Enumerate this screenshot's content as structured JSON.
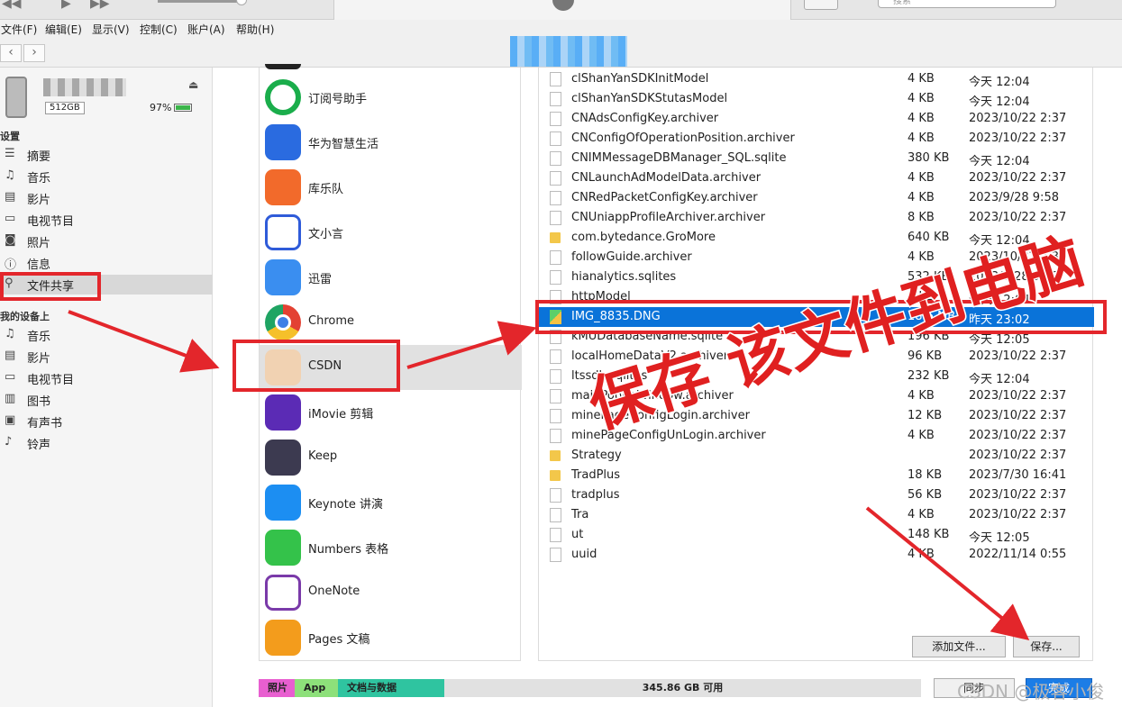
{
  "menu": [
    "文件(F)",
    "编辑(E)",
    "显示(V)",
    "控制(C)",
    "账户(A)",
    "帮助(H)"
  ],
  "search_placeholder": "搜索",
  "device": {
    "storage": "512GB",
    "battery": "97%"
  },
  "sidebar": {
    "settings_title": "设置",
    "settings": [
      {
        "label": "摘要",
        "icon": "list-icon"
      },
      {
        "label": "音乐",
        "icon": "music-icon"
      },
      {
        "label": "影片",
        "icon": "film-icon"
      },
      {
        "label": "电视节目",
        "icon": "tv-icon"
      },
      {
        "label": "照片",
        "icon": "camera-icon"
      },
      {
        "label": "信息",
        "icon": "info-icon"
      },
      {
        "label": "文件共享",
        "icon": "app-store-icon"
      }
    ],
    "mydevice_title": "我的设备上",
    "mydevice": [
      {
        "label": "音乐",
        "icon": "music-icon"
      },
      {
        "label": "影片",
        "icon": "film-icon"
      },
      {
        "label": "电视节目",
        "icon": "tv-icon"
      },
      {
        "label": "图书",
        "icon": "book-icon"
      },
      {
        "label": "有声书",
        "icon": "audiobook-icon"
      },
      {
        "label": "铃声",
        "icon": "bell-icon"
      }
    ]
  },
  "apps": [
    {
      "name": "订阅号助手",
      "color": "#1aad4b"
    },
    {
      "name": "华为智慧生活",
      "color": "#2a6be0"
    },
    {
      "name": "库乐队",
      "color": "#f26a2b"
    },
    {
      "name": "文小言",
      "color": "#2f5bd9"
    },
    {
      "name": "迅雷",
      "color": "#3a8ef0"
    },
    {
      "name": "Chrome",
      "color": "#e34133"
    },
    {
      "name": "CSDN",
      "color": "#f1d2b2"
    },
    {
      "name": "iMovie 剪辑",
      "color": "#5b2bb5"
    },
    {
      "name": "Keep",
      "color": "#3c3a50"
    },
    {
      "name": "Keynote 讲演",
      "color": "#1c8ef2"
    },
    {
      "name": "Numbers 表格",
      "color": "#34c24a"
    },
    {
      "name": "OneNote",
      "color": "#7a3aa9"
    },
    {
      "name": "Pages 文稿",
      "color": "#f39c1c"
    }
  ],
  "files": [
    {
      "name": "clShanYanSDKInitModel",
      "size": "4 KB",
      "date": "今天 12:04",
      "type": "file"
    },
    {
      "name": "clShanYanSDKStutasModel",
      "size": "4 KB",
      "date": "今天 12:04",
      "type": "file"
    },
    {
      "name": "CNAdsConfigKey.archiver",
      "size": "4 KB",
      "date": "2023/10/22 2:37",
      "type": "file"
    },
    {
      "name": "CNConfigOfOperationPosition.archiver",
      "size": "4 KB",
      "date": "2023/10/22 2:37",
      "type": "file"
    },
    {
      "name": "CNIMMessageDBManager_SQL.sqlite",
      "size": "380 KB",
      "date": "今天 12:04",
      "type": "file"
    },
    {
      "name": "CNLaunchAdModelData.archiver",
      "size": "4 KB",
      "date": "2023/10/22 2:37",
      "type": "file"
    },
    {
      "name": "CNRedPacketConfigKey.archiver",
      "size": "4 KB",
      "date": "2023/9/28 9:58",
      "type": "file"
    },
    {
      "name": "CNUniappProfileArchiver.archiver",
      "size": "8 KB",
      "date": "2023/10/22 2:37",
      "type": "file"
    },
    {
      "name": "com.bytedance.GroMore",
      "size": "640 KB",
      "date": "今天 12:04",
      "type": "folder"
    },
    {
      "name": "followGuide.archiver",
      "size": "4 KB",
      "date": "2023/10/22 2:37",
      "type": "file"
    },
    {
      "name": "hianalytics.sqlites",
      "size": "532 KB",
      "date": "2023/9/28 9:59",
      "type": "file"
    },
    {
      "name": "httpModel",
      "size": "4 KB",
      "date": "今天 12:04",
      "type": "file"
    },
    {
      "name": "IMG_8835.DNG",
      "size": "18.6 MB",
      "date": "昨天 23:02",
      "type": "image",
      "selected": true
    },
    {
      "name": "kMUDatabaseName.sqlite",
      "size": "196 KB",
      "date": "今天 12:05",
      "type": "file"
    },
    {
      "name": "localHomeDataV2.archiver",
      "size": "96 KB",
      "date": "2023/10/22 2:37",
      "type": "file"
    },
    {
      "name": "ltssdk.sqlites",
      "size": "232 KB",
      "date": "今天 12:04",
      "type": "file"
    },
    {
      "name": "mainPopupWindow.archiver",
      "size": "4 KB",
      "date": "2023/10/22 2:37",
      "type": "file"
    },
    {
      "name": "minePageConfigLogin.archiver",
      "size": "12 KB",
      "date": "2023/10/22 2:37",
      "type": "file"
    },
    {
      "name": "minePageConfigUnLogin.archiver",
      "size": "4 KB",
      "date": "2023/10/22 2:37",
      "type": "file"
    },
    {
      "name": "Strategy",
      "size": "",
      "date": "2023/10/22 2:37",
      "type": "folder"
    },
    {
      "name": "TradPlus",
      "size": "18 KB",
      "date": "2023/7/30 16:41",
      "type": "folder"
    },
    {
      "name": "tradplus",
      "size": "56 KB",
      "date": "2023/10/22 2:37",
      "type": "file"
    },
    {
      "name": "Tra",
      "size": "4 KB",
      "date": "2023/10/22 2:37",
      "type": "file"
    },
    {
      "name": "ut",
      "size": "148 KB",
      "date": "今天 12:05",
      "type": "file"
    },
    {
      "name": "uuid",
      "size": "4 KB",
      "date": "2022/11/14 0:55",
      "type": "file"
    }
  ],
  "buttons": {
    "add_file": "添加文件...",
    "save": "保存...",
    "sync": "同步",
    "done": "完成"
  },
  "capacity": {
    "photos": "照片",
    "apps": "App",
    "docs": "文档与数据",
    "free": "345.86 GB 可用",
    "photos_color": "#e85fd0",
    "apps_color": "#8de07a",
    "docs_color": "#2fc4a0"
  },
  "annotation": {
    "text": "保存 该文件到电脑",
    "color": "#e3262b"
  },
  "watermark": "CSDN @极客小俊"
}
